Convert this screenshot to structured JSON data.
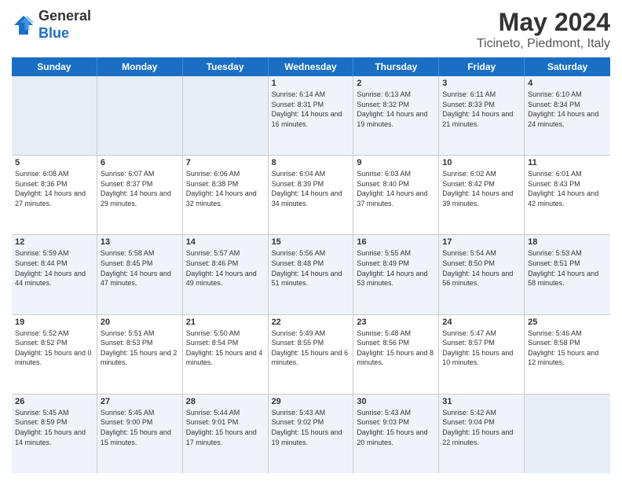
{
  "logo": {
    "line1": "General",
    "line2": "Blue"
  },
  "title": "May 2024",
  "location": "Ticineto, Piedmont, Italy",
  "weekdays": [
    "Sunday",
    "Monday",
    "Tuesday",
    "Wednesday",
    "Thursday",
    "Friday",
    "Saturday"
  ],
  "rows": [
    [
      {
        "day": "",
        "empty": true
      },
      {
        "day": "",
        "empty": true
      },
      {
        "day": "",
        "empty": true
      },
      {
        "day": "1",
        "sunrise": "Sunrise: 6:14 AM",
        "sunset": "Sunset: 8:31 PM",
        "daylight": "Daylight: 14 hours and 16 minutes."
      },
      {
        "day": "2",
        "sunrise": "Sunrise: 6:13 AM",
        "sunset": "Sunset: 8:32 PM",
        "daylight": "Daylight: 14 hours and 19 minutes."
      },
      {
        "day": "3",
        "sunrise": "Sunrise: 6:11 AM",
        "sunset": "Sunset: 8:33 PM",
        "daylight": "Daylight: 14 hours and 21 minutes."
      },
      {
        "day": "4",
        "sunrise": "Sunrise: 6:10 AM",
        "sunset": "Sunset: 8:34 PM",
        "daylight": "Daylight: 14 hours and 24 minutes."
      }
    ],
    [
      {
        "day": "5",
        "sunrise": "Sunrise: 6:08 AM",
        "sunset": "Sunset: 8:36 PM",
        "daylight": "Daylight: 14 hours and 27 minutes."
      },
      {
        "day": "6",
        "sunrise": "Sunrise: 6:07 AM",
        "sunset": "Sunset: 8:37 PM",
        "daylight": "Daylight: 14 hours and 29 minutes."
      },
      {
        "day": "7",
        "sunrise": "Sunrise: 6:06 AM",
        "sunset": "Sunset: 8:38 PM",
        "daylight": "Daylight: 14 hours and 32 minutes."
      },
      {
        "day": "8",
        "sunrise": "Sunrise: 6:04 AM",
        "sunset": "Sunset: 8:39 PM",
        "daylight": "Daylight: 14 hours and 34 minutes."
      },
      {
        "day": "9",
        "sunrise": "Sunrise: 6:03 AM",
        "sunset": "Sunset: 8:40 PM",
        "daylight": "Daylight: 14 hours and 37 minutes."
      },
      {
        "day": "10",
        "sunrise": "Sunrise: 6:02 AM",
        "sunset": "Sunset: 8:42 PM",
        "daylight": "Daylight: 14 hours and 39 minutes."
      },
      {
        "day": "11",
        "sunrise": "Sunrise: 6:01 AM",
        "sunset": "Sunset: 8:43 PM",
        "daylight": "Daylight: 14 hours and 42 minutes."
      }
    ],
    [
      {
        "day": "12",
        "sunrise": "Sunrise: 5:59 AM",
        "sunset": "Sunset: 8:44 PM",
        "daylight": "Daylight: 14 hours and 44 minutes."
      },
      {
        "day": "13",
        "sunrise": "Sunrise: 5:58 AM",
        "sunset": "Sunset: 8:45 PM",
        "daylight": "Daylight: 14 hours and 47 minutes."
      },
      {
        "day": "14",
        "sunrise": "Sunrise: 5:57 AM",
        "sunset": "Sunset: 8:46 PM",
        "daylight": "Daylight: 14 hours and 49 minutes."
      },
      {
        "day": "15",
        "sunrise": "Sunrise: 5:56 AM",
        "sunset": "Sunset: 8:48 PM",
        "daylight": "Daylight: 14 hours and 51 minutes."
      },
      {
        "day": "16",
        "sunrise": "Sunrise: 5:55 AM",
        "sunset": "Sunset: 8:49 PM",
        "daylight": "Daylight: 14 hours and 53 minutes."
      },
      {
        "day": "17",
        "sunrise": "Sunrise: 5:54 AM",
        "sunset": "Sunset: 8:50 PM",
        "daylight": "Daylight: 14 hours and 56 minutes."
      },
      {
        "day": "18",
        "sunrise": "Sunrise: 5:53 AM",
        "sunset": "Sunset: 8:51 PM",
        "daylight": "Daylight: 14 hours and 58 minutes."
      }
    ],
    [
      {
        "day": "19",
        "sunrise": "Sunrise: 5:52 AM",
        "sunset": "Sunset: 8:52 PM",
        "daylight": "Daylight: 15 hours and 0 minutes."
      },
      {
        "day": "20",
        "sunrise": "Sunrise: 5:51 AM",
        "sunset": "Sunset: 8:53 PM",
        "daylight": "Daylight: 15 hours and 2 minutes."
      },
      {
        "day": "21",
        "sunrise": "Sunrise: 5:50 AM",
        "sunset": "Sunset: 8:54 PM",
        "daylight": "Daylight: 15 hours and 4 minutes."
      },
      {
        "day": "22",
        "sunrise": "Sunrise: 5:49 AM",
        "sunset": "Sunset: 8:55 PM",
        "daylight": "Daylight: 15 hours and 6 minutes."
      },
      {
        "day": "23",
        "sunrise": "Sunrise: 5:48 AM",
        "sunset": "Sunset: 8:56 PM",
        "daylight": "Daylight: 15 hours and 8 minutes."
      },
      {
        "day": "24",
        "sunrise": "Sunrise: 5:47 AM",
        "sunset": "Sunset: 8:57 PM",
        "daylight": "Daylight: 15 hours and 10 minutes."
      },
      {
        "day": "25",
        "sunrise": "Sunrise: 5:46 AM",
        "sunset": "Sunset: 8:58 PM",
        "daylight": "Daylight: 15 hours and 12 minutes."
      }
    ],
    [
      {
        "day": "26",
        "sunrise": "Sunrise: 5:45 AM",
        "sunset": "Sunset: 8:59 PM",
        "daylight": "Daylight: 15 hours and 14 minutes."
      },
      {
        "day": "27",
        "sunrise": "Sunrise: 5:45 AM",
        "sunset": "Sunset: 9:00 PM",
        "daylight": "Daylight: 15 hours and 15 minutes."
      },
      {
        "day": "28",
        "sunrise": "Sunrise: 5:44 AM",
        "sunset": "Sunset: 9:01 PM",
        "daylight": "Daylight: 15 hours and 17 minutes."
      },
      {
        "day": "29",
        "sunrise": "Sunrise: 5:43 AM",
        "sunset": "Sunset: 9:02 PM",
        "daylight": "Daylight: 15 hours and 19 minutes."
      },
      {
        "day": "30",
        "sunrise": "Sunrise: 5:43 AM",
        "sunset": "Sunset: 9:03 PM",
        "daylight": "Daylight: 15 hours and 20 minutes."
      },
      {
        "day": "31",
        "sunrise": "Sunrise: 5:42 AM",
        "sunset": "Sunset: 9:04 PM",
        "daylight": "Daylight: 15 hours and 22 minutes."
      },
      {
        "day": "",
        "empty": true
      }
    ]
  ]
}
